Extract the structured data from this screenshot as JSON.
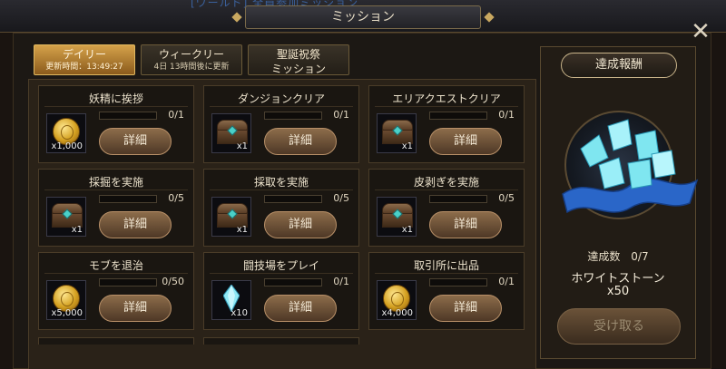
{
  "window": {
    "title": "ミッション",
    "close_label": "✕",
    "behind_text": "[ワールド] 全員参加ミッション"
  },
  "tabs": [
    {
      "label": "デイリー",
      "sub": "更新時間：13:49:27",
      "active": true
    },
    {
      "label": "ウィークリー",
      "sub": "4日 13時間後に更新",
      "active": false
    },
    {
      "label": "聖誕祝祭",
      "sub": "ミッション",
      "active": false
    }
  ],
  "missions": [
    {
      "title": "妖精に挨拶",
      "progress": "0/1",
      "progress_fraction": 0,
      "reward_icon": "gold-coin-icon",
      "reward_qty": "x1,000",
      "button": "詳細"
    },
    {
      "title": "ダンジョンクリア",
      "progress": "0/1",
      "progress_fraction": 0,
      "reward_icon": "treasure-chest-icon",
      "reward_qty": "x1",
      "button": "詳細"
    },
    {
      "title": "エリアクエストクリア",
      "progress": "0/1",
      "progress_fraction": 0,
      "reward_icon": "treasure-chest-icon",
      "reward_qty": "x1",
      "button": "詳細"
    },
    {
      "title": "採掘を実施",
      "progress": "0/5",
      "progress_fraction": 0,
      "reward_icon": "treasure-chest-icon",
      "reward_qty": "x1",
      "button": "詳細"
    },
    {
      "title": "採取を実施",
      "progress": "0/5",
      "progress_fraction": 0,
      "reward_icon": "treasure-chest-icon",
      "reward_qty": "x1",
      "button": "詳細"
    },
    {
      "title": "皮剥ぎを実施",
      "progress": "0/5",
      "progress_fraction": 0,
      "reward_icon": "treasure-chest-icon",
      "reward_qty": "x1",
      "button": "詳細"
    },
    {
      "title": "モブを退治",
      "progress": "0/50",
      "progress_fraction": 0,
      "reward_icon": "gold-coin-icon",
      "reward_qty": "x5,000",
      "button": "詳細"
    },
    {
      "title": "闘技場をプレイ",
      "progress": "0/1",
      "progress_fraction": 0,
      "reward_icon": "crystal-icon",
      "reward_qty": "x10",
      "button": "詳細"
    },
    {
      "title": "取引所に出品",
      "progress": "0/1",
      "progress_fraction": 0,
      "reward_icon": "gold-coin-icon",
      "reward_qty": "x4,000",
      "button": "詳細"
    }
  ],
  "reward": {
    "title": "達成報酬",
    "count_label": "達成数",
    "count_value": "0/7",
    "item_name": "ホワイトストーン",
    "item_qty": "x50",
    "claim_label": "受け取る",
    "claim_enabled": false
  },
  "colors": {
    "active_tab": "#d5a24a",
    "progress_fill": "#6fb03a",
    "crystal": "#7fe6f0",
    "ribbon": "#2a66c8"
  }
}
